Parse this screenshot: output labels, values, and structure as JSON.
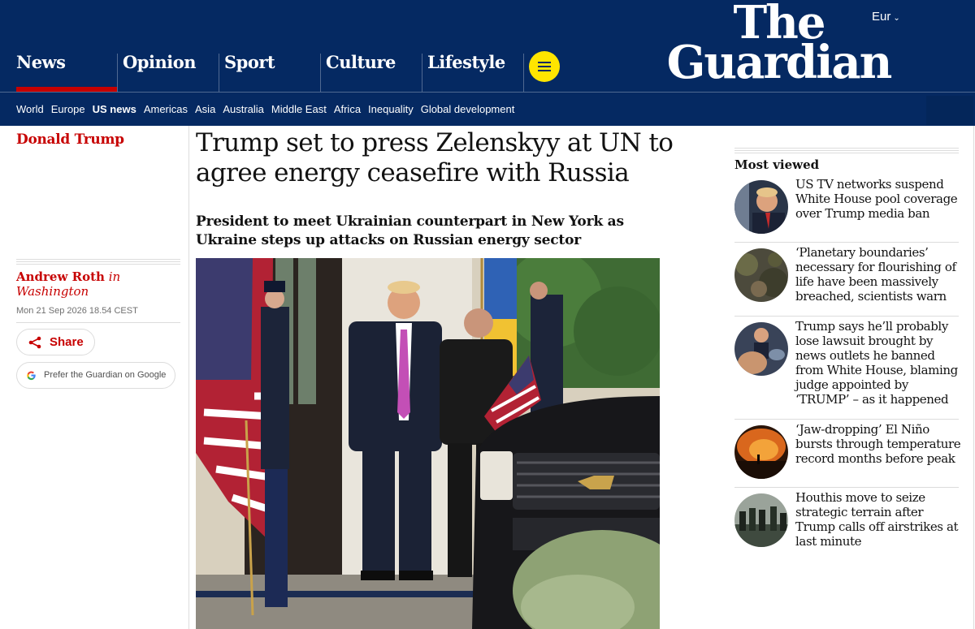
{
  "header": {
    "pillars": [
      {
        "label": "News",
        "active": true
      },
      {
        "label": "Opinion",
        "active": false
      },
      {
        "label": "Sport",
        "active": false
      },
      {
        "label": "Culture",
        "active": false
      },
      {
        "label": "Lifestyle",
        "active": false
      }
    ],
    "logo_line1": "The",
    "logo_line2": "Guardian",
    "edition": "Eur",
    "subnav": [
      {
        "label": "World",
        "active": false
      },
      {
        "label": "Europe",
        "active": false
      },
      {
        "label": "US news",
        "active": true
      },
      {
        "label": "Americas",
        "active": false
      },
      {
        "label": "Asia",
        "active": false
      },
      {
        "label": "Australia",
        "active": false
      },
      {
        "label": "Middle East",
        "active": false
      },
      {
        "label": "Africa",
        "active": false
      },
      {
        "label": "Inequality",
        "active": false
      },
      {
        "label": "Global development",
        "active": false
      }
    ]
  },
  "article": {
    "section": "Donald Trump",
    "headline": "Trump set to press Zelenskyy at UN to agree energy ceasefire with Russia",
    "standfirst": "President to meet Ukrainian counterpart in New York as Ukraine steps up attacks on Russian energy sector",
    "byline_name": "Andrew Roth",
    "byline_in": "in",
    "byline_location": "Washington",
    "dateline": "Mon 21 Sep 2026 18.54 CEST",
    "share_label": "Share",
    "google_label": "Prefer the Guardian on Google"
  },
  "most_viewed": {
    "title": "Most viewed",
    "items": [
      {
        "text": "US TV networks suspend White House pool coverage over Trump media ban"
      },
      {
        "text": "‘Planetary boundaries’ necessary for flourishing of life have been massively breached, scientists warn"
      },
      {
        "text": "Trump says he’ll probably lose lawsuit brought by news outlets he banned from White House, blaming judge appointed by ‘TRUMP’ – as it happened"
      },
      {
        "text": "‘Jaw-dropping’ El Niño bursts through temperature record months before peak"
      },
      {
        "text": "Houthis move to seize strategic terrain after Trump calls off airstrikes at last minute"
      }
    ]
  },
  "colors": {
    "brand_blue": "#052962",
    "news_red": "#c70000",
    "menu_yellow": "#ffe500"
  },
  "icons": [
    "menu-icon",
    "chevron-down-icon",
    "share-icon",
    "google-icon"
  ]
}
